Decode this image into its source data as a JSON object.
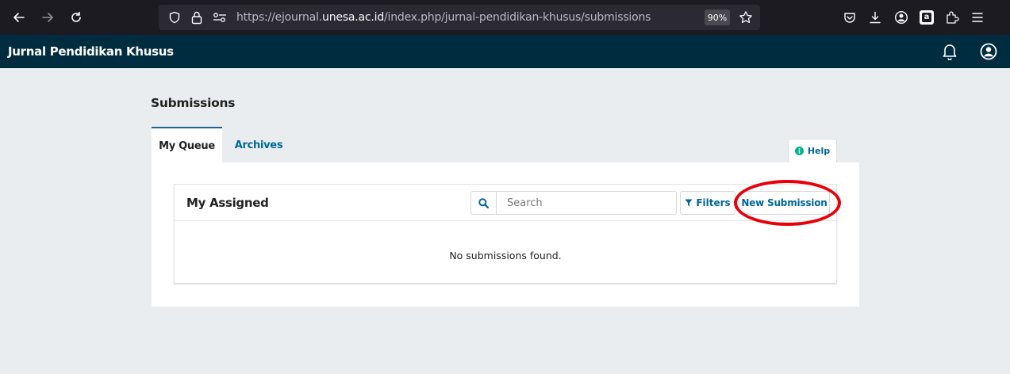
{
  "browser": {
    "url_prefix": "https://ejournal.",
    "url_domain": "unesa.ac.id",
    "url_path": "/index.php/jurnal-pendidikan-khusus/submissions",
    "zoom": "90%"
  },
  "app": {
    "title": "Jurnal Pendidikan Khusus"
  },
  "page": {
    "title": "Submissions",
    "tabs": [
      {
        "label": "My Queue"
      },
      {
        "label": "Archives"
      }
    ],
    "help_label": "Help"
  },
  "list": {
    "title": "My Assigned",
    "search_placeholder": "Search",
    "filters_label": "Filters",
    "new_submission_label": "New Submission",
    "empty_message": "No submissions found."
  },
  "colors": {
    "header_bg": "#002c40",
    "link": "#006798",
    "highlight": "#e8000b"
  }
}
